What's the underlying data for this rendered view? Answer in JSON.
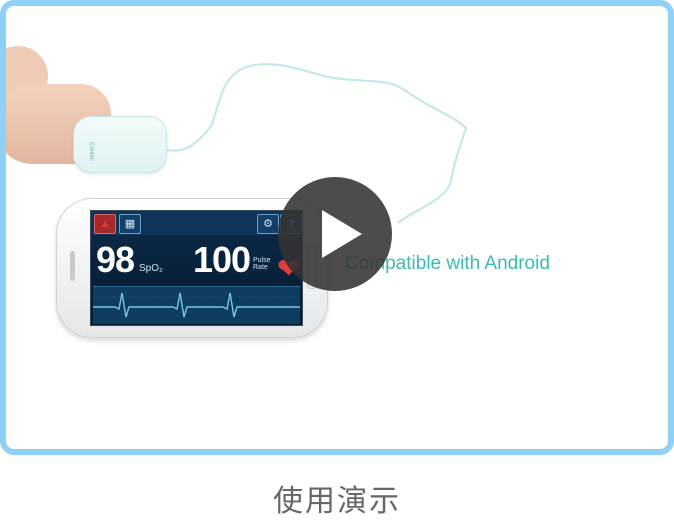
{
  "video": {
    "overlay_caption": "Compatible with Android",
    "play_icon": "play-icon",
    "sensor_brand": "Contec"
  },
  "device_screen": {
    "spo2_value": "98",
    "spo2_label": "SpO₂",
    "pulse_value": "100",
    "pulse_label": "Pulse Rate",
    "icons": [
      "bell-icon",
      "grid-icon",
      "gear-icon",
      "help-icon"
    ]
  },
  "bottom_title": "使用演示",
  "colors": {
    "frame_border": "#8fd0f7",
    "caption_teal": "#3bbcb1",
    "play_bg": "#333333",
    "title_gray": "#666666"
  }
}
